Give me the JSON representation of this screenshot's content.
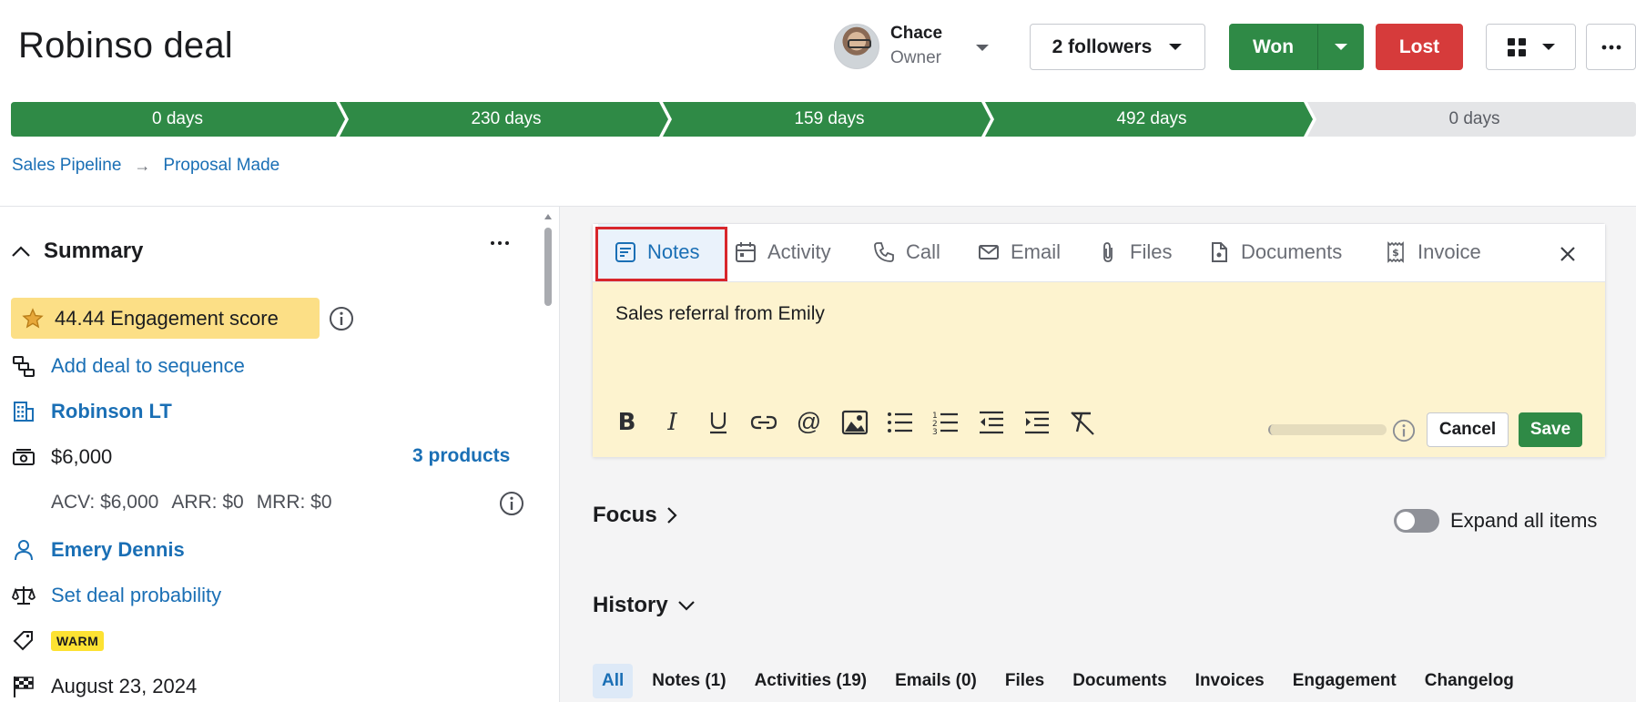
{
  "deal": {
    "title": "Robinso deal"
  },
  "owner": {
    "name": "Chace",
    "role": "Owner"
  },
  "header": {
    "followers_label": "2 followers",
    "won_label": "Won",
    "lost_label": "Lost"
  },
  "pipeline": {
    "stages": [
      {
        "label": "0 days",
        "status": "done"
      },
      {
        "label": "230 days",
        "status": "done"
      },
      {
        "label": "159 days",
        "status": "done"
      },
      {
        "label": "492 days",
        "status": "done"
      },
      {
        "label": "0 days",
        "status": "pending"
      }
    ],
    "colors": {
      "done": "#2f8a46",
      "pending": "#e4e5e7"
    }
  },
  "breadcrumb": {
    "pipeline": "Sales Pipeline",
    "stage": "Proposal Made"
  },
  "summary": {
    "title": "Summary",
    "engagement": "44.44 Engagement score",
    "add_sequence": "Add deal to sequence",
    "organization": "Robinson LT",
    "value": "$6,000",
    "products": "3 products",
    "acv": "ACV: $6,000",
    "arr": "ARR: $0",
    "mrr": "MRR: $0",
    "person": "Emery Dennis",
    "probability": "Set deal probability",
    "label_tag": "WARM",
    "close_date": "August 23, 2024"
  },
  "composer": {
    "tabs": [
      {
        "label": "Notes",
        "icon": "note-icon",
        "active": true
      },
      {
        "label": "Activity",
        "icon": "calendar-icon"
      },
      {
        "label": "Call",
        "icon": "phone-icon"
      },
      {
        "label": "Email",
        "icon": "envelope-icon"
      },
      {
        "label": "Files",
        "icon": "paperclip-icon"
      },
      {
        "label": "Documents",
        "icon": "document-icon"
      },
      {
        "label": "Invoice",
        "icon": "invoice-icon"
      }
    ],
    "note_text": "Sales referral from Emily",
    "cancel_label": "Cancel",
    "save_label": "Save"
  },
  "focus": {
    "title": "Focus"
  },
  "expand": {
    "label": "Expand all items"
  },
  "history": {
    "title": "History",
    "filters": [
      {
        "label": "All",
        "active": true
      },
      {
        "label": "Notes (1)"
      },
      {
        "label": "Activities (19)"
      },
      {
        "label": "Emails (0)"
      },
      {
        "label": "Files"
      },
      {
        "label": "Documents"
      },
      {
        "label": "Invoices"
      },
      {
        "label": "Engagement"
      },
      {
        "label": "Changelog"
      }
    ]
  },
  "colors": {
    "accent": "#1a6fb5",
    "won": "#2f8a46",
    "lost": "#d63b3b",
    "note_bg": "#fdf3cf",
    "highlight": "#d8262c"
  }
}
